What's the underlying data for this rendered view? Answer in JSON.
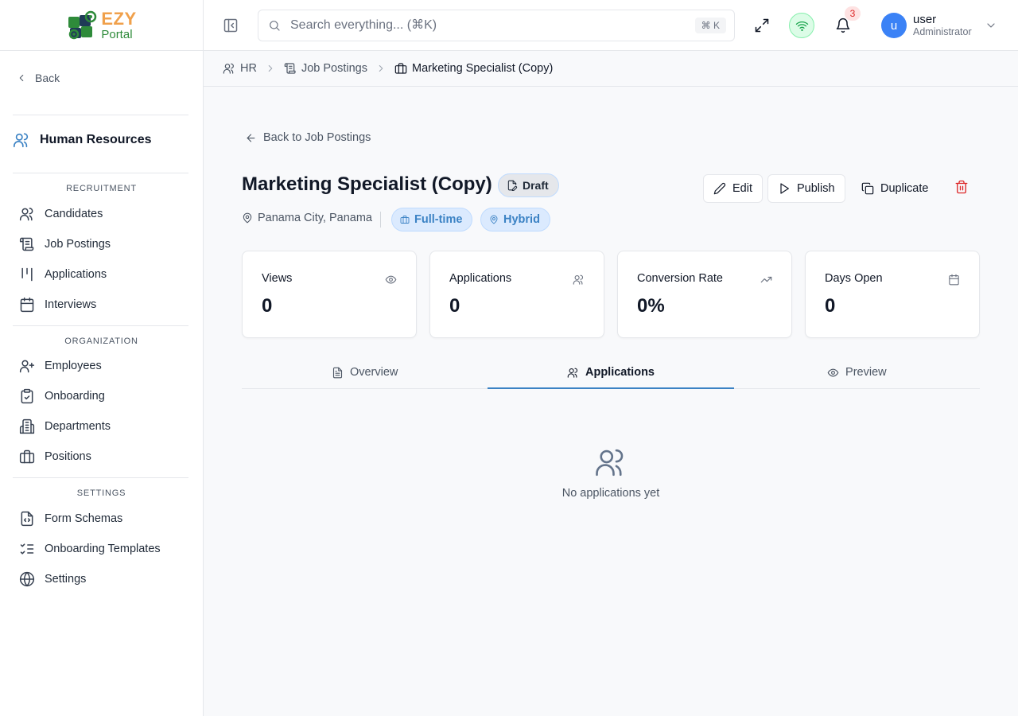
{
  "app": {
    "logo_top": "EZY",
    "logo_bottom": "Portal"
  },
  "sidebar": {
    "back_label": "Back",
    "module_title": "Human Resources",
    "sections": {
      "recruitment": "RECRUITMENT",
      "organization": "ORGANIZATION",
      "settings": "SETTINGS"
    },
    "items": {
      "candidates": "Candidates",
      "job_postings": "Job Postings",
      "applications": "Applications",
      "interviews": "Interviews",
      "employees": "Employees",
      "onboarding": "Onboarding",
      "departments": "Departments",
      "positions": "Positions",
      "form_schemas": "Form Schemas",
      "onboarding_templates": "Onboarding Templates",
      "settings": "Settings"
    }
  },
  "header": {
    "search_placeholder": "Search everything... (⌘K)",
    "search_shortcut": "⌘ K",
    "notification_count": "3",
    "user": {
      "initial": "u",
      "name": "user",
      "role": "Administrator"
    }
  },
  "breadcrumb": {
    "hr": "HR",
    "job_postings": "Job Postings",
    "current": "Marketing Specialist (Copy)"
  },
  "posting": {
    "back_label": "Back to Job Postings",
    "title": "Marketing Specialist (Copy)",
    "status": "Draft",
    "location": "Panama City, Panama",
    "employment_type": "Full-time",
    "work_mode": "Hybrid"
  },
  "actions": {
    "edit": "Edit",
    "publish": "Publish",
    "duplicate": "Duplicate"
  },
  "stats": {
    "views": {
      "label": "Views",
      "value": "0"
    },
    "applications": {
      "label": "Applications",
      "value": "0"
    },
    "conversion": {
      "label": "Conversion Rate",
      "value": "0%"
    },
    "days_open": {
      "label": "Days Open",
      "value": "0"
    }
  },
  "tabs": {
    "overview": "Overview",
    "applications": "Applications",
    "preview": "Preview"
  },
  "empty_state": {
    "message": "No applications yet"
  },
  "colors": {
    "accent": "#3b82c4",
    "danger": "#dc2626",
    "online": "#16a34a",
    "avatar": "#3b82f6"
  }
}
